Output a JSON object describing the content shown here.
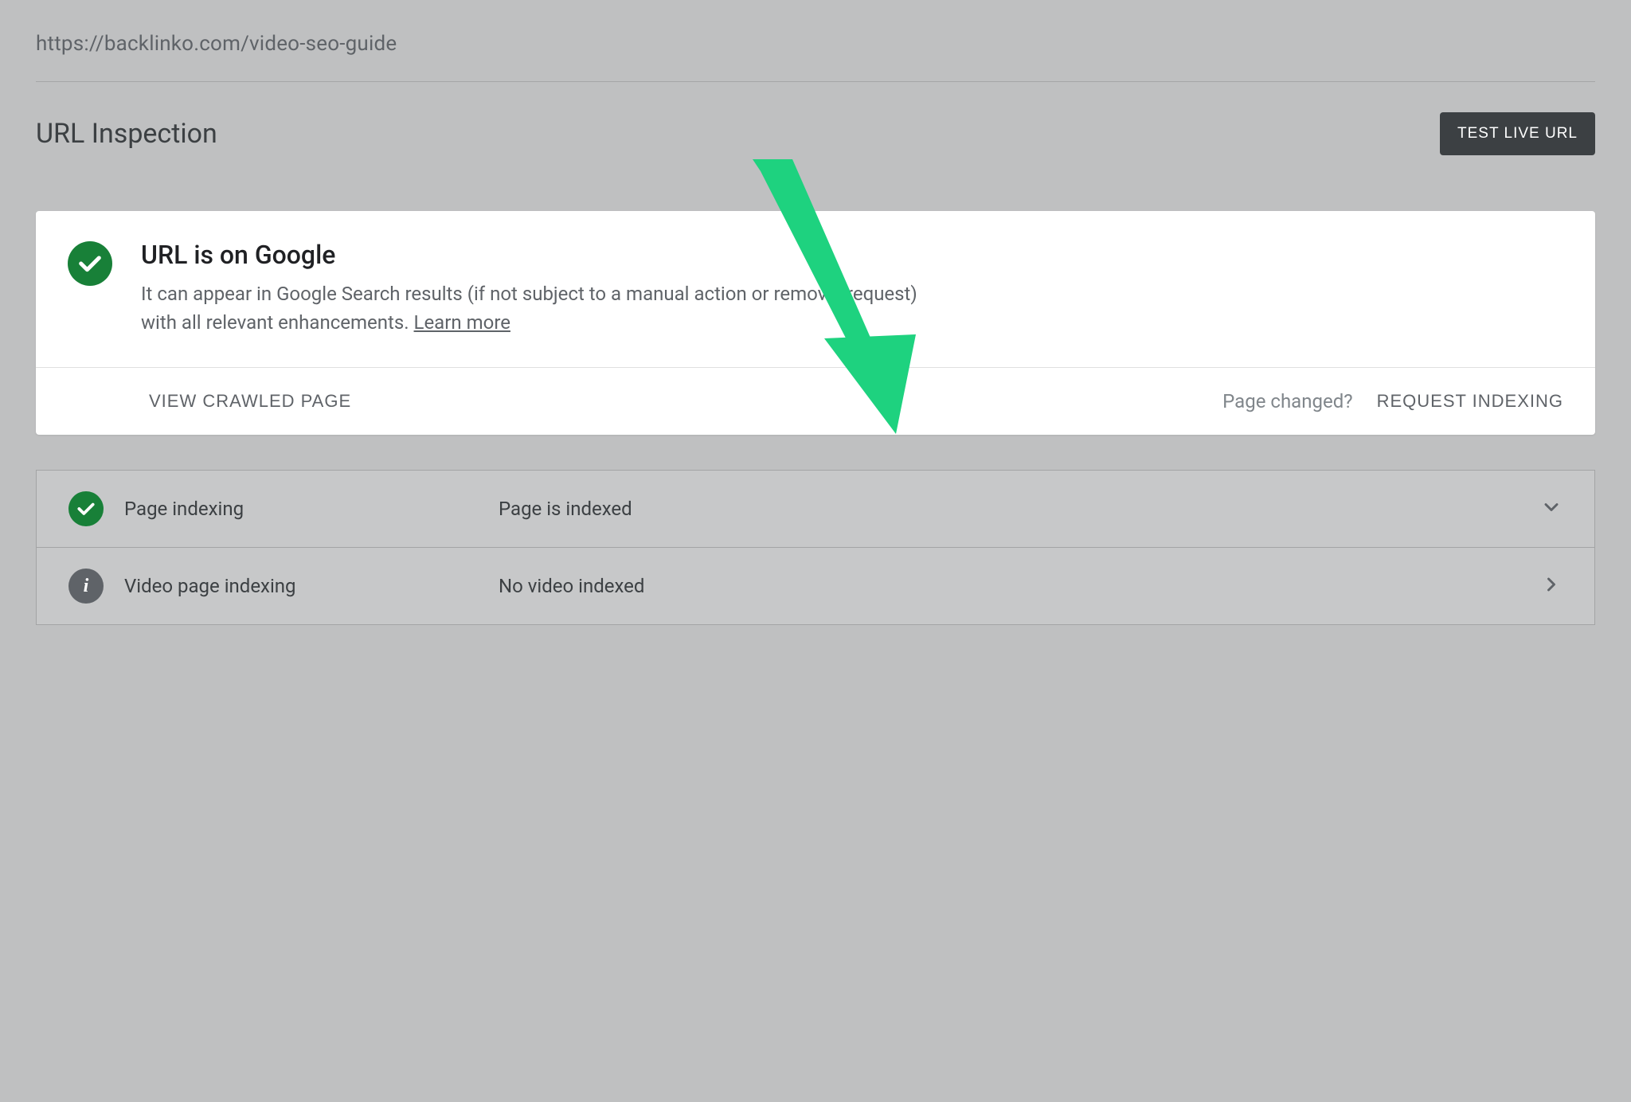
{
  "url": "https://backlinko.com/video-seo-guide",
  "pageTitle": "URL Inspection",
  "testLiveBtn": "TEST LIVE URL",
  "statusCard": {
    "title": "URL is on Google",
    "desc": "It can appear in Google Search results (if not subject to a manual action or removal request) with all relevant enhancements. ",
    "learnMore": "Learn more",
    "viewCrawled": "VIEW CRAWLED PAGE",
    "pageChanged": "Page changed?",
    "requestIndexing": "REQUEST INDEXING"
  },
  "rows": [
    {
      "label": "Page indexing",
      "value": "Page is indexed",
      "iconType": "check",
      "chevron": "down"
    },
    {
      "label": "Video page indexing",
      "value": "No video indexed",
      "iconType": "info",
      "chevron": "right"
    }
  ],
  "annotationArrowColor": "#1ed27f"
}
